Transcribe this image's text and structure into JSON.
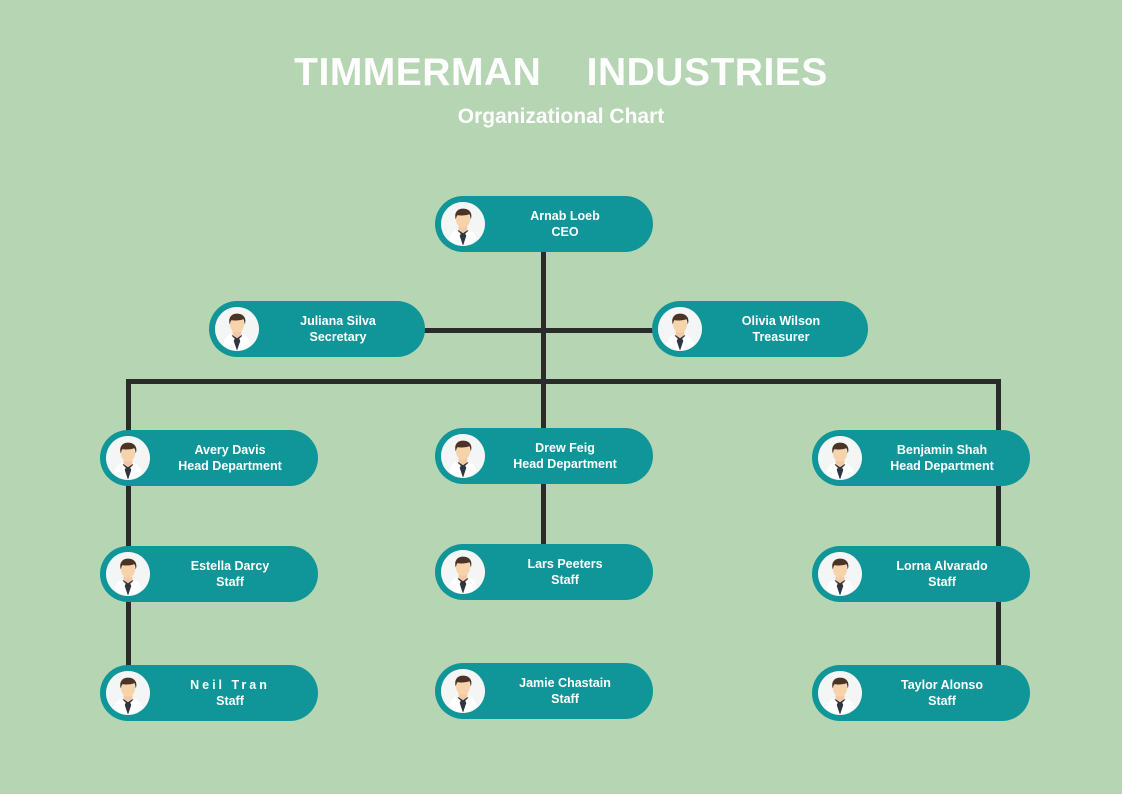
{
  "header": {
    "title": "TIMMERMAN    INDUSTRIES",
    "subtitle": "Organizational Chart"
  },
  "colors": {
    "background": "#b6d6b3",
    "node": "#109599",
    "connector": "#2b2b2b",
    "text": "#ffffff"
  },
  "chart_data": {
    "type": "diagram",
    "title": "TIMMERMAN    INDUSTRIES",
    "subtitle": "Organizational Chart",
    "nodes": [
      {
        "id": "ceo",
        "name": "Arnab Loeb",
        "role": "CEO",
        "level": 1
      },
      {
        "id": "secretary",
        "name": "Juliana Silva",
        "role": "Secretary",
        "level": 2
      },
      {
        "id": "treasurer",
        "name": "Olivia Wilson",
        "role": "Treasurer",
        "level": 2
      },
      {
        "id": "head-left",
        "name": "Avery Davis",
        "role": "Head Department",
        "level": 3
      },
      {
        "id": "head-mid",
        "name": "Drew Feig",
        "role": "Head Department",
        "level": 3
      },
      {
        "id": "head-right",
        "name": "Benjamin Shah",
        "role": "Head Department",
        "level": 3
      },
      {
        "id": "staff-left-1",
        "name": "Estella Darcy",
        "role": "Staff",
        "level": 4
      },
      {
        "id": "staff-mid-1",
        "name": "Lars Peeters",
        "role": "Staff",
        "level": 4
      },
      {
        "id": "staff-right-1",
        "name": "Lorna Alvarado",
        "role": "Staff",
        "level": 4
      },
      {
        "id": "staff-left-2",
        "name": "Neil Tran",
        "role": "Staff",
        "level": 5
      },
      {
        "id": "staff-mid-2",
        "name": "Jamie Chastain",
        "role": "Staff",
        "level": 5
      },
      {
        "id": "staff-right-2",
        "name": "Taylor Alonso",
        "role": "Staff",
        "level": 5
      }
    ],
    "edges": [
      {
        "from": "ceo",
        "to": "secretary"
      },
      {
        "from": "ceo",
        "to": "treasurer"
      },
      {
        "from": "ceo",
        "to": "head-left"
      },
      {
        "from": "ceo",
        "to": "head-mid"
      },
      {
        "from": "ceo",
        "to": "head-right"
      },
      {
        "from": "head-left",
        "to": "staff-left-1"
      },
      {
        "from": "staff-left-1",
        "to": "staff-left-2"
      },
      {
        "from": "head-mid",
        "to": "staff-mid-1"
      },
      {
        "from": "head-right",
        "to": "staff-right-1"
      },
      {
        "from": "staff-right-1",
        "to": "staff-right-2"
      }
    ]
  },
  "nodes": {
    "ceo": {
      "name": "Arnab Loeb",
      "role": "CEO"
    },
    "secretary": {
      "name": "Juliana Silva",
      "role": "Secretary"
    },
    "treasurer": {
      "name": "Olivia Wilson",
      "role": "Treasurer"
    },
    "head_left": {
      "name": "Avery Davis",
      "role": "Head Department"
    },
    "head_mid": {
      "name": "Drew Feig",
      "role": "Head Department"
    },
    "head_right": {
      "name": "Benjamin Shah",
      "role": "Head Department"
    },
    "staff_l1": {
      "name": "Estella Darcy",
      "role": "Staff"
    },
    "staff_m1": {
      "name": "Lars Peeters",
      "role": "Staff"
    },
    "staff_r1": {
      "name": "Lorna Alvarado",
      "role": "Staff"
    },
    "staff_l2": {
      "name": "Neil Tran",
      "role": "Staff"
    },
    "staff_m2": {
      "name": "Jamie Chastain",
      "role": "Staff"
    },
    "staff_r2": {
      "name": "Taylor Alonso",
      "role": "Staff"
    }
  },
  "icons": {
    "avatar": "person-avatar-icon"
  }
}
